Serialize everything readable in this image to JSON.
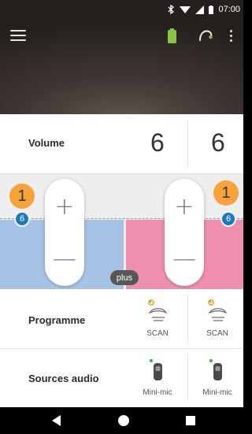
{
  "status_bar": {
    "time": "07:00",
    "icons": [
      "bluetooth-icon",
      "wifi-icon",
      "signal-icon",
      "battery-icon"
    ]
  },
  "header": {
    "icons": [
      "menu-icon",
      "battery-icon",
      "hearing-aid-icon",
      "more-vert-icon"
    ],
    "battery_color": "#8bc34a"
  },
  "volume": {
    "label": "Volume",
    "left": "6",
    "right": "6"
  },
  "control": {
    "left": {
      "program_number": "1",
      "volume_number": "6",
      "color": "#a6c3e5"
    },
    "right": {
      "program_number": "1",
      "volume_number": "6",
      "color": "#ee8fb0"
    },
    "plus_label": "plus",
    "plus_symbol": "+",
    "minus_symbol": "—"
  },
  "programme": {
    "label": "Programme",
    "left": {
      "caption": "SCAN",
      "icon": "scan-icon"
    },
    "right": {
      "caption": "SCAN",
      "icon": "scan-icon"
    }
  },
  "sources_audio": {
    "label": "Sources audio",
    "left": {
      "caption": "Mini-mic",
      "icon": "mini-mic-icon",
      "status_color": "#4caf50"
    },
    "right": {
      "caption": "Mini-mic",
      "icon": "mini-mic-icon",
      "status_color": "#4caf50"
    }
  },
  "nav_bar": {
    "icons": [
      "back-icon",
      "home-icon",
      "recent-apps-icon"
    ]
  }
}
